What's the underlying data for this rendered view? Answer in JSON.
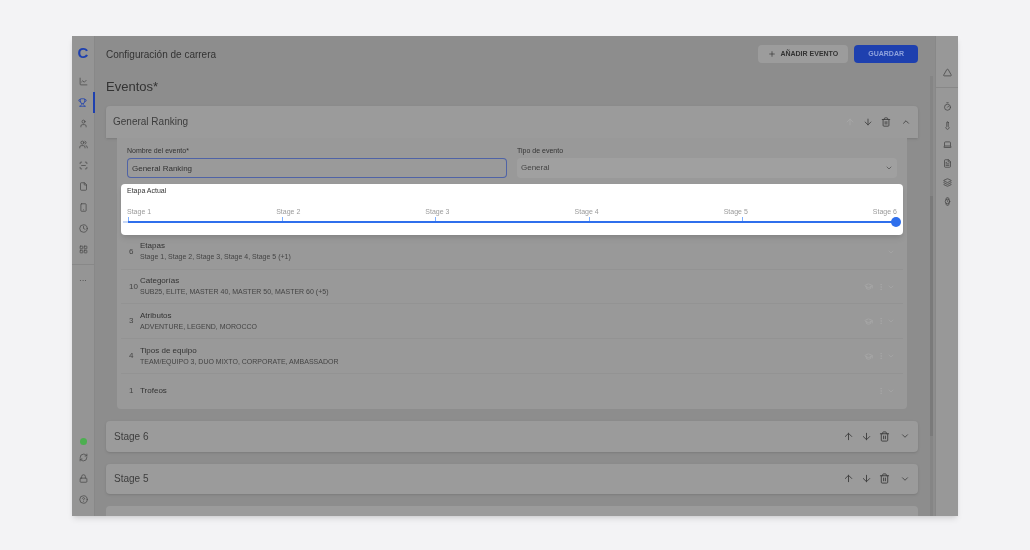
{
  "sidebar": {
    "logo": "C",
    "items": [
      {
        "selected": false
      },
      {
        "selected": true
      },
      {
        "selected": false
      },
      {
        "selected": false
      },
      {
        "selected": false
      },
      {
        "selected": false
      },
      {
        "selected": false
      },
      {
        "selected": false
      },
      {
        "selected": false
      }
    ],
    "more": "···"
  },
  "header": {
    "title": "Configuración de carrera",
    "buttons": [
      {
        "kind": "secondary",
        "label": "AÑADIR EVENTO"
      },
      {
        "kind": "primary",
        "label": "GUARDAR"
      }
    ]
  },
  "section_title": "Eventos*",
  "event": {
    "title": "General Ranking",
    "expanded": true,
    "name_field": {
      "label": "Nombre del evento*",
      "value": "General Ranking"
    },
    "type_field": {
      "label": "Tipo de evento",
      "value": "General"
    },
    "current_stage": {
      "label": "Etapa Actual",
      "level": 1,
      "stages": [
        {
          "label": "Stage 1"
        },
        {
          "label": "Stage 2"
        },
        {
          "label": "Stage 3"
        },
        {
          "label": "Stage 4"
        },
        {
          "label": "Stage 5"
        },
        {
          "label": "Stage 6"
        }
      ]
    },
    "groups": [
      {
        "count": "6",
        "title": "Etapas",
        "summary": "Stage 1, Stage 2, Stage 3, Stage 4, Stage 5 (+1)",
        "kind": "plain"
      },
      {
        "count": "10",
        "title": "Categorías",
        "summary": "SUB25, ELITE, MASTER 40, MASTER 50, MASTER 60 (+5)",
        "kind": "full"
      },
      {
        "count": "3",
        "title": "Atributos",
        "summary": "ADVENTURE, LEGEND, MOROCCO",
        "kind": "full"
      },
      {
        "count": "4",
        "title": "Tipos de equipo",
        "summary": "TEAM/EQUIPO 3, DUO MIXTO, CORPORATE, AMBASSADOR",
        "kind": "full"
      },
      {
        "count": "1",
        "title": "Trofeos",
        "kind": "menu"
      }
    ]
  },
  "other_events": [
    {
      "title": "Stage 6",
      "expanded": false
    },
    {
      "title": "Stage 5",
      "expanded": false
    }
  ]
}
